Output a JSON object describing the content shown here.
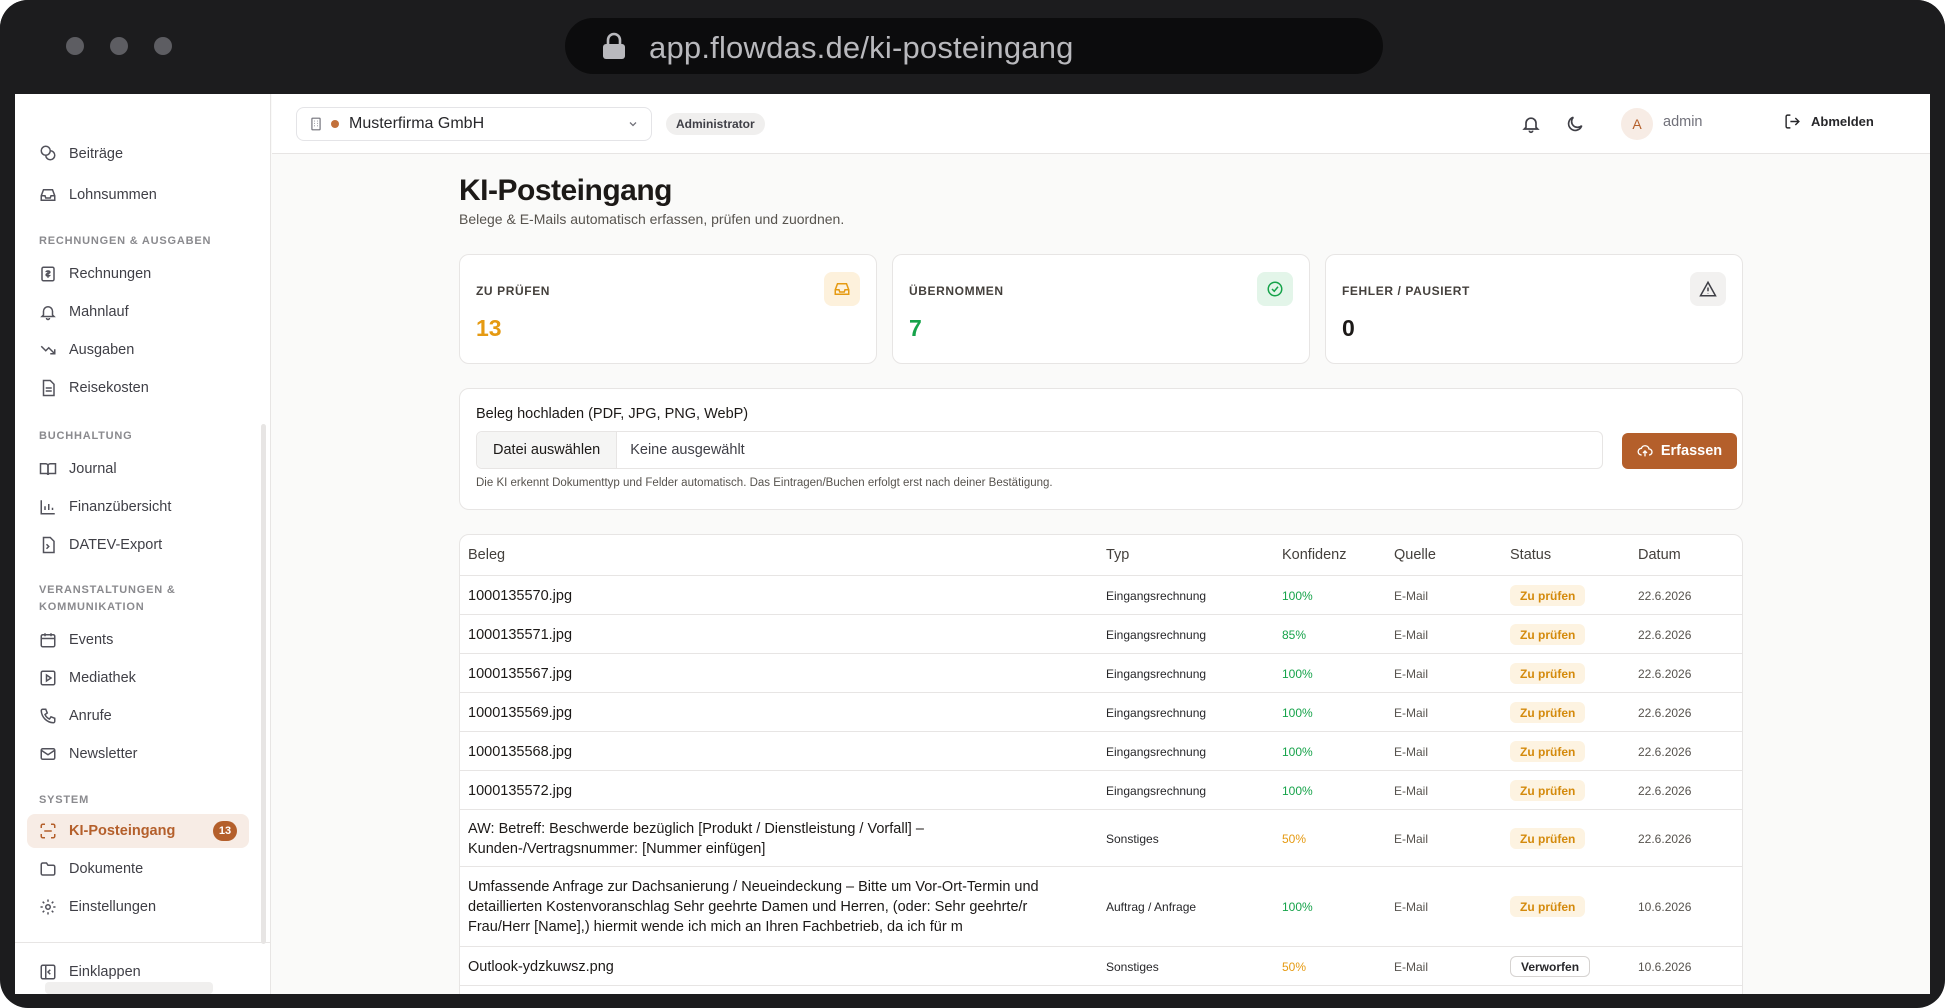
{
  "browser": {
    "url": "app.flowdas.de/ki-posteingang"
  },
  "sidebar": {
    "top_items": [
      {
        "label": "Beiträge",
        "icon": "coins-icon"
      },
      {
        "label": "Lohnsummen",
        "icon": "inbox-icon"
      }
    ],
    "sections": [
      {
        "title": "RECHNUNGEN & AUSGABEN",
        "items": [
          {
            "label": "Rechnungen",
            "icon": "receipt-icon"
          },
          {
            "label": "Mahnlauf",
            "icon": "bell-icon"
          },
          {
            "label": "Ausgaben",
            "icon": "trending-down-icon"
          },
          {
            "label": "Reisekosten",
            "icon": "file-text-icon"
          }
        ]
      },
      {
        "title": "BUCHHALTUNG",
        "items": [
          {
            "label": "Journal",
            "icon": "book-icon"
          },
          {
            "label": "Finanzübersicht",
            "icon": "bar-chart-icon"
          },
          {
            "label": "DATEV-Export",
            "icon": "file-export-icon"
          }
        ]
      },
      {
        "title_line1": "VERANSTALTUNGEN &",
        "title_line2": "KOMMUNIKATION",
        "items": [
          {
            "label": "Events",
            "icon": "calendar-icon"
          },
          {
            "label": "Mediathek",
            "icon": "play-square-icon"
          },
          {
            "label": "Anrufe",
            "icon": "phone-icon"
          },
          {
            "label": "Newsletter",
            "icon": "mail-icon"
          }
        ]
      },
      {
        "title": "SYSTEM",
        "items": [
          {
            "label": "KI-Posteingang",
            "icon": "scan-icon",
            "badge": "13",
            "active": true
          },
          {
            "label": "Dokumente",
            "icon": "folder-icon"
          },
          {
            "label": "Einstellungen",
            "icon": "gear-icon"
          }
        ]
      }
    ],
    "collapse_label": "Einklappen"
  },
  "topbar": {
    "company": "Musterfirma GmbH",
    "role": "Administrator",
    "user_initial": "A",
    "user_name": "admin",
    "logout_label": "Abmelden"
  },
  "page": {
    "title": "KI-Posteingang",
    "subtitle": "Belege & E-Mails automatisch erfassen, prüfen und zuordnen."
  },
  "stats": [
    {
      "label": "ZU PRÜFEN",
      "value": "13",
      "color": "#e59a12",
      "icon": "inbox-icon",
      "icon_bg": "#fdf1dc"
    },
    {
      "label": "ÜBERNOMMEN",
      "value": "7",
      "color": "#16a34a",
      "icon": "check-circle-icon",
      "icon_bg": "#e3f5e9"
    },
    {
      "label": "FEHLER / PAUSIERT",
      "value": "0",
      "color": "#1c1917",
      "icon": "warning-icon",
      "icon_bg": "#f2f1f0"
    }
  ],
  "upload": {
    "label": "Beleg hochladen (PDF, JPG, PNG, WebP)",
    "file_button": "Datei auswählen",
    "file_status": "Keine ausgewählt",
    "submit": "Erfassen",
    "hint": "Die KI erkennt Dokumenttyp und Felder automatisch. Das Eintragen/Buchen erfolgt erst nach deiner Bestätigung."
  },
  "table": {
    "headers": [
      "Beleg",
      "Typ",
      "Konfidenz",
      "Quelle",
      "Status",
      "Datum"
    ],
    "rows": [
      {
        "beleg": "1000135570.jpg",
        "typ": "Eingangsrechnung",
        "konfidenz": "100%",
        "quelle": "E-Mail",
        "status": "Zu prüfen",
        "datum": "22.6.2026"
      },
      {
        "beleg": "1000135571.jpg",
        "typ": "Eingangsrechnung",
        "konfidenz": "85%",
        "quelle": "E-Mail",
        "status": "Zu prüfen",
        "datum": "22.6.2026"
      },
      {
        "beleg": "1000135567.jpg",
        "typ": "Eingangsrechnung",
        "konfidenz": "100%",
        "quelle": "E-Mail",
        "status": "Zu prüfen",
        "datum": "22.6.2026"
      },
      {
        "beleg": "1000135569.jpg",
        "typ": "Eingangsrechnung",
        "konfidenz": "100%",
        "quelle": "E-Mail",
        "status": "Zu prüfen",
        "datum": "22.6.2026"
      },
      {
        "beleg": "1000135568.jpg",
        "typ": "Eingangsrechnung",
        "konfidenz": "100%",
        "quelle": "E-Mail",
        "status": "Zu prüfen",
        "datum": "22.6.2026"
      },
      {
        "beleg": "1000135572.jpg",
        "typ": "Eingangsrechnung",
        "konfidenz": "100%",
        "quelle": "E-Mail",
        "status": "Zu prüfen",
        "datum": "22.6.2026"
      },
      {
        "beleg": "AW: Betreff: Beschwerde bezüglich [Produkt / Dienstleistung / Vorfall] – Kunden-/Vertragsnummer: [Nummer einfügen]",
        "typ": "Sonstiges",
        "konfidenz": "50%",
        "quelle": "E-Mail",
        "status": "Zu prüfen",
        "datum": "22.6.2026"
      },
      {
        "beleg": "Umfassende Anfrage zur Dachsanierung / Neueindeckung – Bitte um Vor-Ort-Termin und detaillierten Kostenvoranschlag Sehr geehrte Damen und Herren, (oder: Sehr geehrte/r Frau/Herr [Name],) hiermit wende ich mich an Ihren Fachbetrieb, da ich für m",
        "typ": "Auftrag / Anfrage",
        "konfidenz": "100%",
        "quelle": "E-Mail",
        "status": "Zu prüfen",
        "datum": "10.6.2026"
      },
      {
        "beleg": "Outlook-ydzkuwsz.png",
        "typ": "Sonstiges",
        "konfidenz": "50%",
        "quelle": "E-Mail",
        "status": "Verworfen",
        "datum": "10.6.2026"
      }
    ]
  },
  "colors": {
    "accent": "#b45f2b",
    "confidence_high": "#16a34a",
    "confidence_mid": "#e59a12"
  }
}
